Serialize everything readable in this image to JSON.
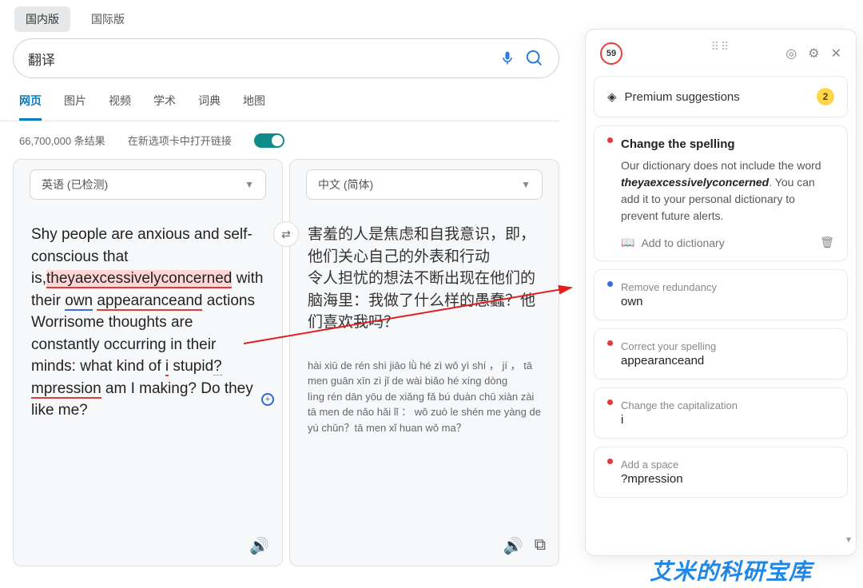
{
  "top_tabs": {
    "domestic": "国内版",
    "intl": "国际版"
  },
  "search": {
    "query": "翻译"
  },
  "nav": {
    "web": "网页",
    "image": "图片",
    "video": "视频",
    "scholar": "学术",
    "dict": "词典",
    "map": "地图"
  },
  "results": {
    "count": "66,700,000 条结果",
    "open_new_tab": "在新选项卡中打开链接"
  },
  "translate": {
    "src_lang": "英语 (已检测)",
    "dst_lang": "中文 (简体)",
    "src_parts": {
      "p1": "Shy people are anxious and self-conscious that is,",
      "err1": "theyaexcessivelyconcerned",
      "p2": " with their ",
      "blue1": "own",
      "p3": " ",
      "err2": "appearanceand",
      "p4": " actions Worrisome thoughts are constantly occurring in their minds: what kind of ",
      "err3": "i",
      "p5": " stupid",
      "dash1": "?",
      "err4": "mpression",
      "p6": " am I making? Do they like me?"
    },
    "dst_text": "害羞的人是焦虑和自我意识，即，他们关心自己的外表和行动\n令人担忧的想法不断出现在他们的脑海里：我做了什么样的愚蠢？他们喜欢我吗？",
    "pinyin": "hài xiū de rén shì jiāo lǜ hé zì wǒ yì shí ， jí ， tā men guān xīn zì jǐ de wài biǎo hé xíng dòng\nlìng rén dān yōu de xiǎng fǎ bú duàn chū xiàn zài tā men de nǎo hǎi lǐ ： wǒ zuò le shén me yàng de yú chǔn？tā men xǐ huan wǒ ma？"
  },
  "grammarly": {
    "score": "59",
    "premium_label": "Premium suggestions",
    "premium_count": "2",
    "main": {
      "title": "Change the spelling",
      "desc1": "Our dictionary does not include the word ",
      "word": "theyaexcessivelyconcerned",
      "desc2": ". You can add it to your personal dictionary to prevent future alerts.",
      "add": "Add to dictionary"
    },
    "s1": {
      "title": "Remove redundancy",
      "word": "own"
    },
    "s2": {
      "title": "Correct your spelling",
      "word": "appearanceand"
    },
    "s3": {
      "title": "Change the capitalization",
      "word": "i"
    },
    "s4": {
      "title": "Add a space",
      "word": "?mpression"
    }
  },
  "watermark": "艾米的科研宝库"
}
